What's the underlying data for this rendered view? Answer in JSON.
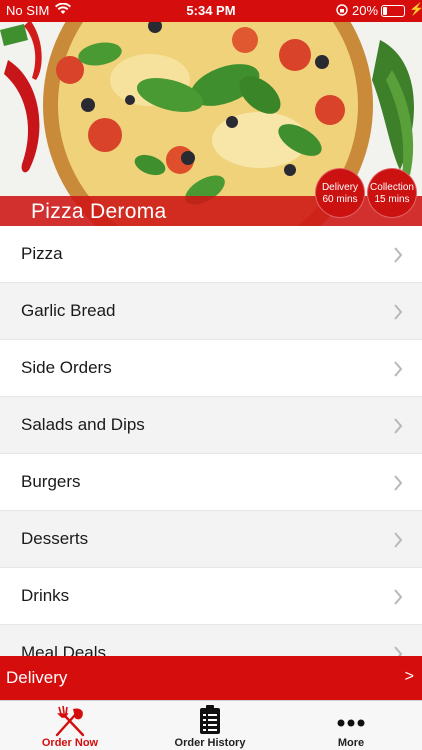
{
  "status_bar": {
    "carrier": "No SIM",
    "time": "5:34 PM",
    "battery_percent": "20%",
    "battery_level": 0.2
  },
  "restaurant": {
    "name": "Pizza Deroma",
    "delivery_badge": {
      "title": "Delivery",
      "time": "60 mins"
    },
    "collection_badge": {
      "title": "Collection",
      "time": "15 mins"
    }
  },
  "menu": {
    "items": [
      {
        "label": "Pizza"
      },
      {
        "label": "Garlic Bread"
      },
      {
        "label": "Side Orders"
      },
      {
        "label": "Salads and Dips"
      },
      {
        "label": "Burgers"
      },
      {
        "label": "Desserts"
      },
      {
        "label": "Drinks"
      },
      {
        "label": "Meal Deals"
      }
    ]
  },
  "delivery_bar": {
    "label": "Delivery",
    "arrow": ">"
  },
  "tabs": [
    {
      "label": "Order Now",
      "icon": "fork-knife-icon"
    },
    {
      "label": "Order History",
      "icon": "clipboard-icon"
    },
    {
      "label": "More",
      "icon": "more-dots-icon"
    }
  ],
  "colors": {
    "brand_red": "#d60d0d",
    "row_alt": "#f3f3f3"
  }
}
